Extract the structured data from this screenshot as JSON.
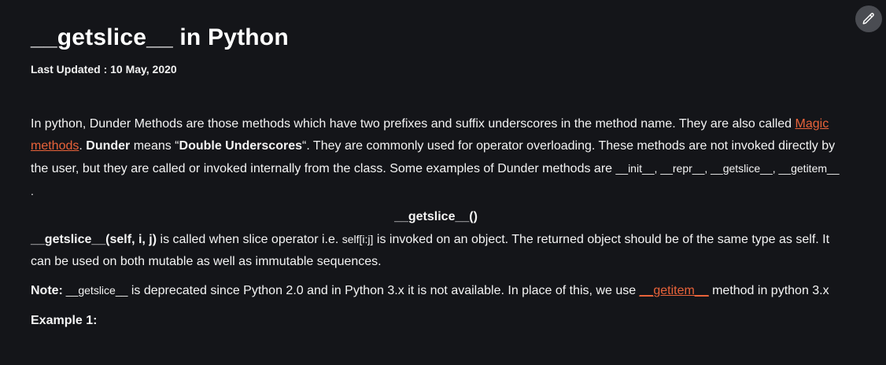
{
  "toolbar": {
    "edit_icon": "pencil-icon"
  },
  "article": {
    "title": "__getslice__ in Python",
    "last_updated": "Last Updated : 10 May, 2020",
    "intro": {
      "part1": "In python, Dunder Methods are those methods which have two prefixes and suffix underscores in the method name. They are also called ",
      "magic_link": "Magic methods",
      "part2": ". ",
      "dunder_bold": "Dunder",
      "part3": " means “",
      "double_bold": "Double Underscores",
      "part4": "“. They are commonly used for operator overloading. These methods are not invoked directly by the user, but they are called or invoked internally from the class. Some examples of Dunder methods are ",
      "examples": "__init__, __repr__, __getslice__, __getitem__ ."
    },
    "section_heading": "__getslice__()",
    "description": {
      "signature_bold": "__getslice__(self, i, j)",
      "part1": " is called when slice operator i.e. ",
      "slice_code": "self[i:j]",
      "part2": " is invoked on an object. The returned object should be of the same type as self. It can be used on both mutable as well as immutable sequences."
    },
    "note": {
      "label": "Note:",
      "code": " __getslice__",
      "part1": " is deprecated since Python 2.0 and in Python 3.x it is not available. In place of this, we use ",
      "getitem_link": "__getitem__",
      "part2": " method in python 3.x"
    },
    "example_heading": "Example 1:"
  },
  "colors": {
    "background": "#141519",
    "text": "#ffffff",
    "link": "#e9633a",
    "edit_button_bg": "#4a4c52"
  }
}
